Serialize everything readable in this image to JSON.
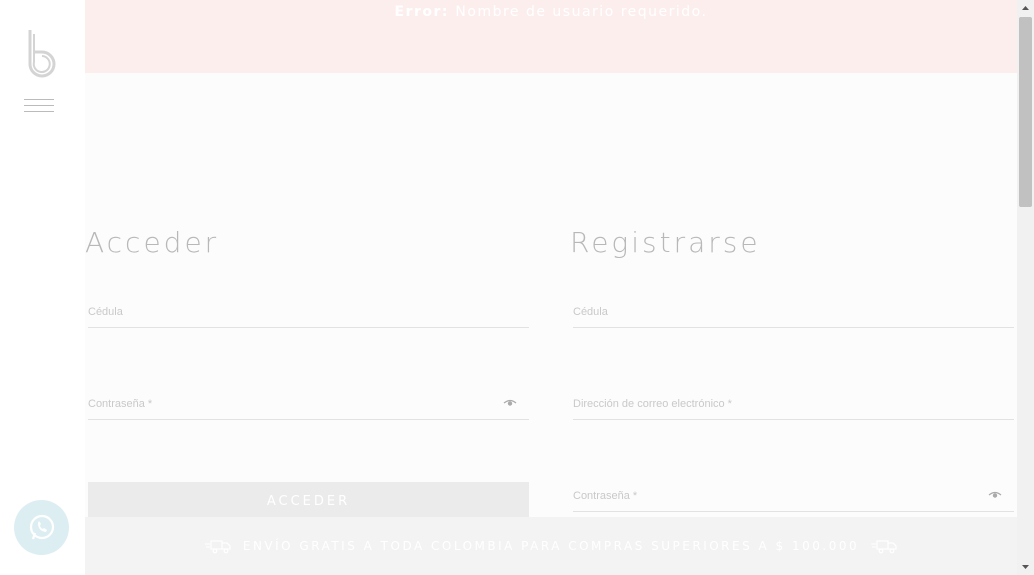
{
  "error": {
    "label": "Error:",
    "message": "Nombre de usuario requerido."
  },
  "login": {
    "title": "Acceder",
    "username_placeholder": "Cédula",
    "password_placeholder": "Contraseña *",
    "button_label": "ACCEDER"
  },
  "register": {
    "title": "Registrarse",
    "username_placeholder": "Cédula",
    "email_placeholder": "Dirección de correo electrónico *",
    "password_placeholder": "Contraseña *"
  },
  "banner": {
    "text": "ENVÍO GRATIS A TODA COLOMBIA PARA COMPRAS SUPERIORES A $ 100.000"
  },
  "icons": {
    "logo": "brand-b-logo",
    "menu": "hamburger-icon",
    "eye": "eye-icon",
    "truck": "delivery-truck-icon",
    "chat": "whatsapp-icon"
  },
  "colors": {
    "error_bg": "#fdeeee",
    "button_bg": "#ebebeb",
    "whatsapp_bg": "#ddeef3"
  }
}
